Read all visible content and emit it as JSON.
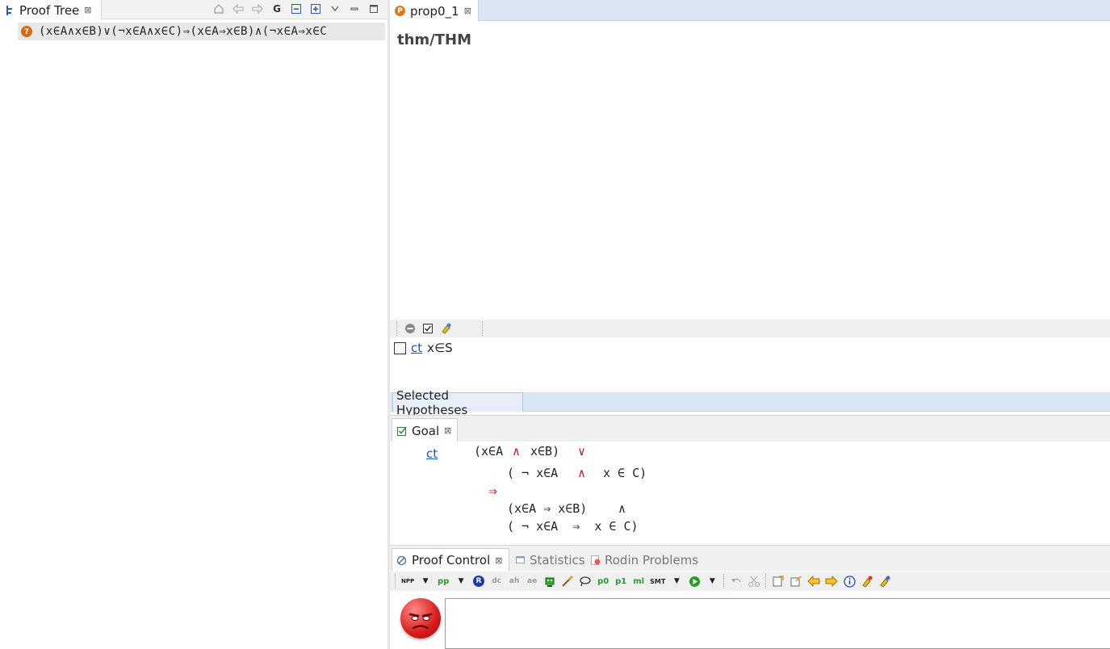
{
  "left": {
    "tab_label": "Proof Tree",
    "tab_close": "⊠",
    "tree_row_text": "(x∈A∧x∈B)∨(¬x∈A∧x∈C)⇒(x∈A⇒x∈B)∧(¬x∈A⇒x∈C",
    "toolbar_g": "G"
  },
  "editor": {
    "tab_label": "prop0_1",
    "tab_close": "⊠",
    "po_title": "thm/THM"
  },
  "hypotheses": {
    "rows": [
      {
        "link": "ct",
        "value": "x∈S"
      }
    ],
    "selected_tab_label": "Selected Hypotheses"
  },
  "goal": {
    "tab_label": "Goal",
    "tab_close": "⊠",
    "link": "ct",
    "lines": {
      "l1_a": "(x∈A",
      "l1_and": "∧",
      "l1_b": "x∈B)",
      "l1_or": "∨",
      "l2_a": "( ¬ x∈A",
      "l2_and": "∧",
      "l2_b": "x ∈ C)",
      "l3_imp": "⇒",
      "l4_a": "(x∈A ⇒ x∈B)",
      "l4_and": "∧",
      "l5": "( ¬ x∈A  ⇒  x ∈ C)"
    }
  },
  "proof_control": {
    "tab_label": "Proof Control",
    "tab_close": "⊠",
    "tab_statistics": "Statistics",
    "tab_rodin": "Rodin Problems",
    "toolbar": {
      "npp": "NPP",
      "pp": "pp",
      "r": "R",
      "dc": "dc",
      "ah": "ah",
      "ae": "ae",
      "p0": "p0",
      "p1": "p1",
      "ml": "ml",
      "smt": "SMT"
    }
  },
  "colors": {
    "accent_tab_bg": "#dbe6f4",
    "red_operator": "#d01818",
    "link_blue": "#1a55c0"
  }
}
